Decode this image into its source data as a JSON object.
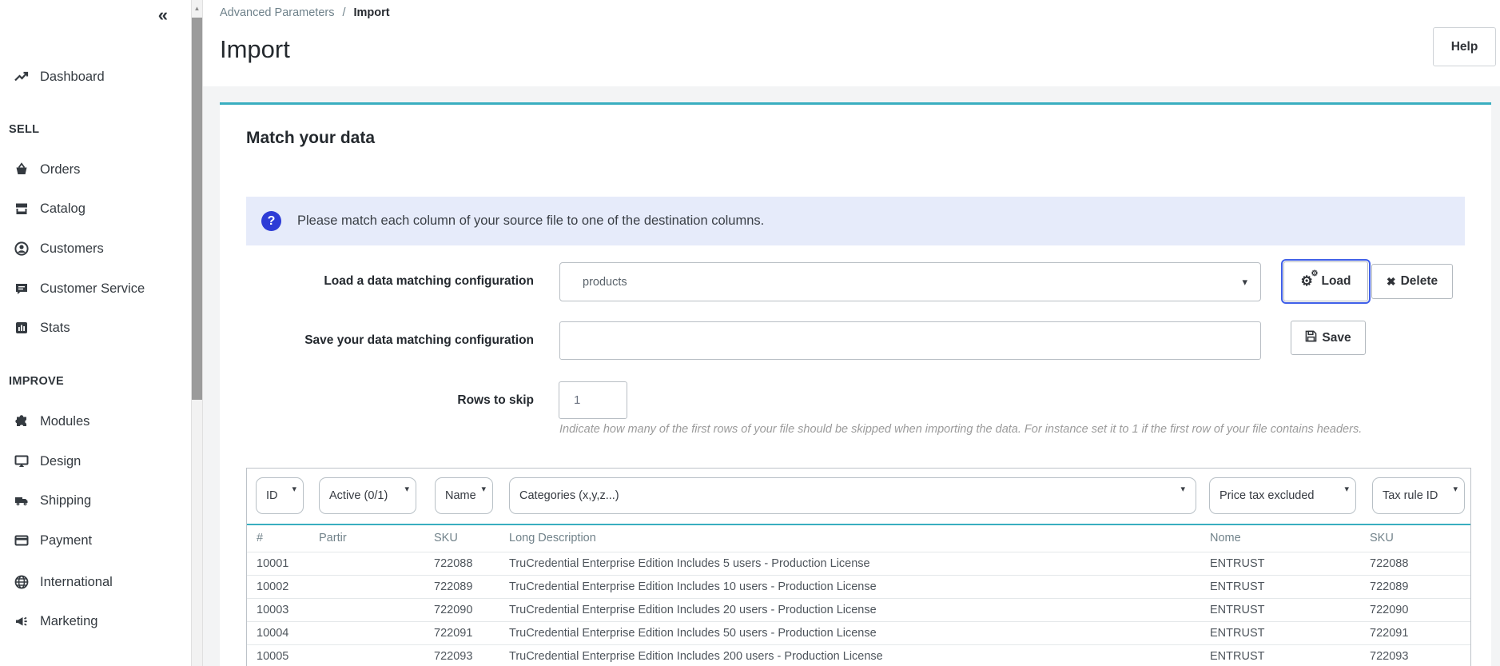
{
  "icons": {
    "collapse": "«",
    "scroll_up": "▲",
    "caret": "▾",
    "info": "?",
    "load_gear": "⚙",
    "delete_x": "✖"
  },
  "colors": {
    "accent_teal": "#39aec0",
    "info_alert_bg": "#e6ebfa",
    "info_icon_blue": "#2e3cd6",
    "focus_ring_blue": "#3f5fe8"
  },
  "sidebar": {
    "dashboard": "Dashboard",
    "sell_title": "SELL",
    "sell": [
      "Orders",
      "Catalog",
      "Customers",
      "Customer Service",
      "Stats"
    ],
    "improve_title": "IMPROVE",
    "improve": [
      "Modules",
      "Design",
      "Shipping",
      "Payment",
      "International",
      "Marketing"
    ]
  },
  "breadcrumb": {
    "parent": "Advanced Parameters",
    "separator": "/",
    "current": "Import"
  },
  "header": {
    "title": "Import",
    "help_label": "Help"
  },
  "panel": {
    "title": "Match your data"
  },
  "alert": {
    "text": "Please match each column of your source file to one of the destination columns."
  },
  "form": {
    "load_label": "Load a data matching configuration",
    "load_value": "products",
    "load_button": "Load",
    "delete_button": "Delete",
    "save_label": "Save your data matching configuration",
    "save_value": "",
    "save_button": "Save",
    "rows_label": "Rows to skip",
    "rows_value": "1",
    "rows_help": "Indicate how many of the first rows of your file should be skipped when importing the data. For instance set it to 1 if the first row of your file contains headers."
  },
  "matching": {
    "selects": [
      "ID",
      "Active (0/1)",
      "Name",
      "Categories (x,y,z...)",
      "Price tax excluded",
      "Tax rule ID"
    ]
  },
  "table": {
    "headers": [
      "#",
      "Partir",
      "SKU",
      "Long Description",
      "Nome",
      "SKU"
    ],
    "rows": [
      [
        "10001",
        "",
        "722088",
        "TruCredential Enterprise Edition Includes 5 users - Production License",
        "ENTRUST",
        "722088"
      ],
      [
        "10002",
        "",
        "722089",
        "TruCredential Enterprise Edition Includes 10 users - Production License",
        "ENTRUST",
        "722089"
      ],
      [
        "10003",
        "",
        "722090",
        "TruCredential Enterprise Edition Includes 20 users - Production License",
        "ENTRUST",
        "722090"
      ],
      [
        "10004",
        "",
        "722091",
        "TruCredential Enterprise Edition Includes 50 users - Production License",
        "ENTRUST",
        "722091"
      ],
      [
        "10005",
        "",
        "722093",
        "TruCredential Enterprise Edition Includes 200 users - Production License",
        "ENTRUST",
        "722093"
      ]
    ]
  }
}
